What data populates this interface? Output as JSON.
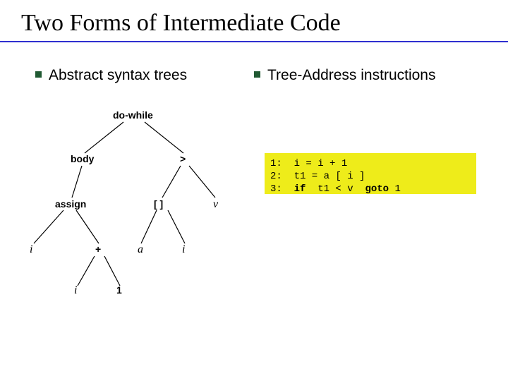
{
  "title": "Two Forms of Intermediate Code",
  "left_heading": "Abstract syntax trees",
  "right_heading": "Tree-Address instructions",
  "tree": {
    "root": "do-while",
    "body": "body",
    "gt": ">",
    "assign": "assign",
    "bracket": "[ ]",
    "v": "v",
    "i1": "i",
    "plus": "+",
    "a": "a",
    "i2": "i",
    "i3": "i",
    "one": "1"
  },
  "code": {
    "l1a": "1:  i = i + 1",
    "l2a": "2:  t1 = a [ i ]",
    "l3a": "3:  ",
    "l3b": "if",
    "l3c": "  t1 < v  ",
    "l3d": "goto",
    "l3e": " 1"
  }
}
